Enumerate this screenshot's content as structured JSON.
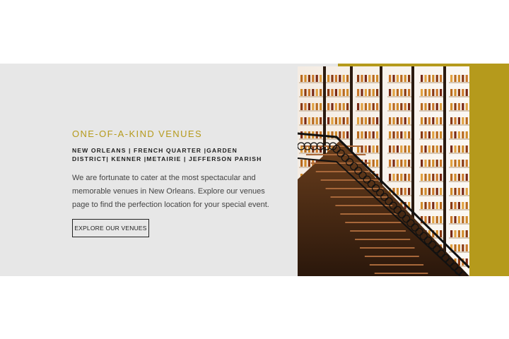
{
  "feature": {
    "heading": "ONE-OF-A-KIND VENUES",
    "locations_line1": "NEW ORLEANS | FRENCH QUARTER |GARDEN",
    "locations_line2": "DISTRICT| KENNER |METAIRIE | JEFFERSON PARISH",
    "description_line1": "We are fortunate to cater at the most spectacular and",
    "description_line2": "memorable venues in New Orleans. Explore our venues",
    "description_line3": "page to find the perfection location for your special event.",
    "button_label": "EXPLORE OUR VENUES"
  },
  "colors": {
    "accent_gold": "#b59a1c",
    "band_gray": "#e7e7e7"
  },
  "image": {
    "subject": "wine-bottle-wall-with-staircase-photo"
  }
}
